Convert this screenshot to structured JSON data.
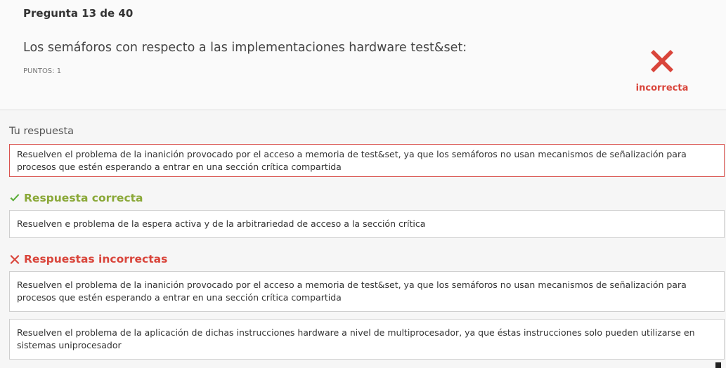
{
  "question": {
    "number": "Pregunta 13 de 40",
    "text": "Los semáforos con respecto a las implementaciones hardware test&set:",
    "points": "PUNTOS: 1",
    "result_label": "incorrecta"
  },
  "your_answer": {
    "label": "Tu respuesta",
    "text": "Resuelven el problema de la inanición provocado por el acceso a memoria de test&set, ya que los semáforos no usan mecanismos de señalización para procesos que estén esperando a entrar en una sección crítica compartida"
  },
  "correct": {
    "title": "Respuesta correcta",
    "answer": "Resuelven e problema de la espera activa y de la arbitrariedad de acceso a la sección crítica"
  },
  "incorrect": {
    "title": "Respuestas incorrectas",
    "answers": [
      "Resuelven el problema de la inanición provocado por el acceso a memoria de test&set, ya que los semáforos no usan mecanismos de señalización para procesos que estén esperando a entrar en una sección crítica compartida",
      "Resuelven el problema de la aplicación de dichas instrucciones hardware a nivel de multiprocesador, ya que éstas instrucciones solo pueden utilizarse en sistemas uniprocesador"
    ]
  },
  "colors": {
    "correct": "#8aa838",
    "incorrect": "#d9453b"
  },
  "icons": {
    "result": "x-icon",
    "correct": "check-icon",
    "incorrect": "x-icon"
  }
}
